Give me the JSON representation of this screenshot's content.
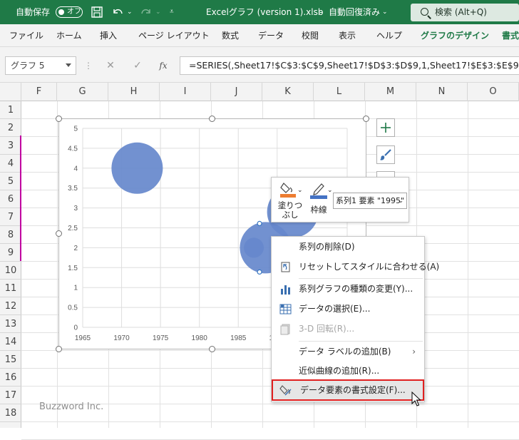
{
  "titlebar": {
    "autosave_label": "自動保存",
    "autosave_state": "オフ",
    "filename": "Excelグラフ (version 1).xlsb",
    "separator": "-",
    "recovered": "自動回復済み",
    "search": "検索 (Alt+Q)"
  },
  "ribbon": {
    "tabs": [
      "ファイル",
      "ホーム",
      "挿入",
      "ページ レイアウト",
      "数式",
      "データ",
      "校閲",
      "表示",
      "ヘルプ",
      "グラフのデザイン",
      "書式"
    ]
  },
  "formula_bar": {
    "name_box": "グラフ 5",
    "formula": "=SERIES(,Sheet17!$C$3:$C$9,Sheet17!$D$3:$D$9,1,Sheet17!$E$3:$E$9)"
  },
  "grid": {
    "columns": [
      "F",
      "G",
      "H",
      "I",
      "J",
      "K",
      "L",
      "M",
      "N",
      "O"
    ],
    "rows": [
      "1",
      "2",
      "3",
      "4",
      "5",
      "6",
      "7",
      "8",
      "9",
      "10",
      "11",
      "12",
      "13",
      "14",
      "15",
      "16",
      "17",
      "18"
    ]
  },
  "chart_data": {
    "type": "bubble",
    "x_ticks": [
      "1965",
      "1970",
      "1975",
      "1980",
      "1985",
      "1990"
    ],
    "y_ticks": [
      "0",
      "0.5",
      "1",
      "1.5",
      "2",
      "2.5",
      "3",
      "3.5",
      "4",
      "4.5",
      "5"
    ],
    "xlim": [
      1965,
      1999
    ],
    "ylim": [
      0,
      5
    ],
    "bubble_color": "#6688cc",
    "points": [
      {
        "x": 1972,
        "y": 4,
        "r": 36
      },
      {
        "x": 1988.5,
        "y": 2,
        "r": 36
      },
      {
        "x": 1992,
        "y": 2.9,
        "r": 36
      },
      {
        "x": 1987,
        "y": 2,
        "r": 14
      }
    ]
  },
  "mini_toolbar": {
    "fill_label_1": "塗りつ",
    "fill_label_2": "ぶし",
    "outline_label": "枠線",
    "series_select": "系列1 要素 \"1995\""
  },
  "context_menu": {
    "items": [
      {
        "label": "系列の削除(D)",
        "icon": "none"
      },
      {
        "label": "リセットしてスタイルに合わせる(A)",
        "icon": "reset-style-icon"
      },
      {
        "label": "系列グラフの種類の変更(Y)...",
        "icon": "chart-type-icon"
      },
      {
        "label": "データの選択(E)...",
        "icon": "select-data-icon"
      },
      {
        "label": "3-D 回転(R)...",
        "icon": "rotate-3d-icon"
      },
      {
        "label": "データ ラベルの追加(B)",
        "icon": "none"
      },
      {
        "label": "近似曲線の追加(R)...",
        "icon": "none"
      },
      {
        "label": "データ要素の書式設定(F)...",
        "icon": "format-point-icon"
      }
    ]
  },
  "watermark": "Buzzword Inc."
}
